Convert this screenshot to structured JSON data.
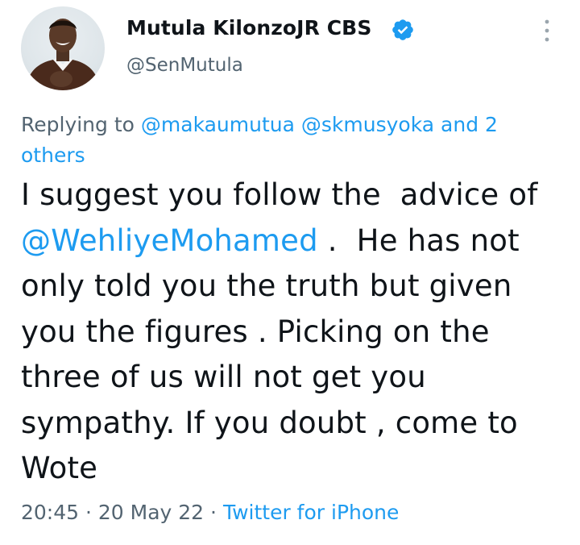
{
  "author": {
    "display_name": "Mutula KilonzoJR CBS",
    "handle": "@SenMutula",
    "verified_icon": "verified-badge-icon",
    "avatar": "avatar"
  },
  "more_icon": "more-vertical-icon",
  "reply": {
    "prefix": "Replying to ",
    "mention1": "@makaumutua",
    "mention2": "@skmusyoka",
    "suffix": " and 2 others"
  },
  "tweet": {
    "part1": "I suggest you follow the  advice of ",
    "mention": "@WehliyeMohamed",
    "part2": " .  He has not only told you the truth but given you the figures . Picking on the three of us will not get you sympathy. If you doubt , come to Wote"
  },
  "meta": {
    "time": "20:45",
    "separator": " · ",
    "date": "20 May 22",
    "source": "Twitter for iPhone"
  },
  "colors": {
    "accent": "#1d9bf0",
    "secondary_text": "#536471",
    "primary_text": "#0f1419"
  }
}
